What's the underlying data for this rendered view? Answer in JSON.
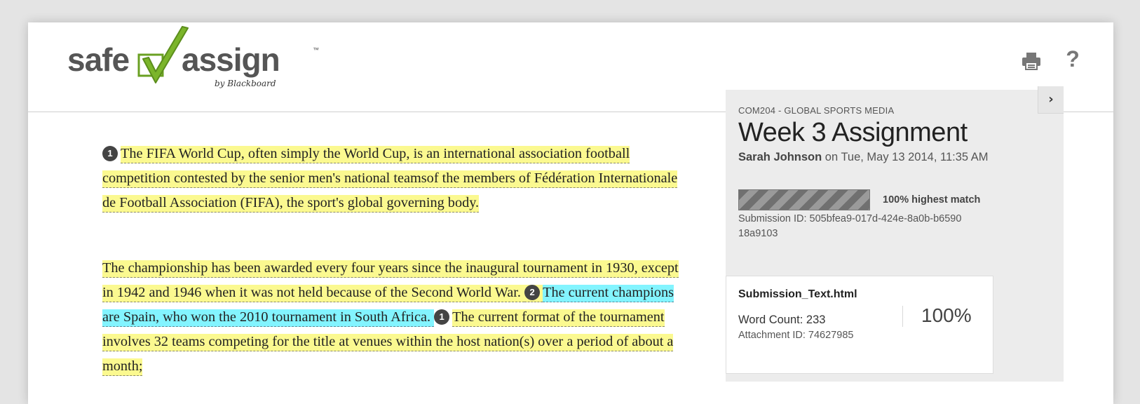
{
  "header": {
    "logo": {
      "word1": "safe",
      "word2": "assign",
      "byline": "by Blackboard",
      "trademark": "™",
      "check_color": "#7bb52a"
    },
    "actions": {
      "print_icon": "printer-icon",
      "help_label": "?"
    }
  },
  "document": {
    "paragraphs": [
      {
        "segments": [
          {
            "type": "marker",
            "text": "1"
          },
          {
            "type": "yellow",
            "text": "The FIFA World Cup, often simply the World Cup, is an international association football competition contested by the senior men's national teamsof the members of Fédération Internationale de Football Association (FIFA), the sport's global governing body."
          }
        ]
      },
      {
        "segments": [
          {
            "type": "yellow",
            "text": " The championship has been awarded every four years since the inaugural tournament in 1930, except in 1942 and 1946 when it was not held because of the Second World War. "
          },
          {
            "type": "marker",
            "text": "2"
          },
          {
            "type": "blue",
            "text": "The current champions are Spain, who won the 2010 tournament in South Africa. "
          },
          {
            "type": "marker",
            "text": "1"
          },
          {
            "type": "yellow",
            "text": "The current format of the tournament involves 32 teams competing for the title at venues within the host nation(s) over a period of about a month;"
          }
        ]
      }
    ],
    "colors": {
      "match_1": "#fbf990",
      "match_2": "#83f4ff"
    }
  },
  "sidebar": {
    "collapse_icon": "chevron-right-icon",
    "course": "COM204 - GLOBAL SPORTS MEDIA",
    "title": "Week 3 Assignment",
    "student": "Sarah Johnson",
    "submitted_prefix": " on ",
    "submitted_date": "Tue, May 13 2014, 11:35 AM",
    "match_fraction": 1.0,
    "match_label": "100% highest match",
    "submission_id": "Submission ID: 505bfea9-017d-424e-8a0b-b659018a9103"
  },
  "attachment": {
    "filename": "Submission_Text.html",
    "word_count": "Word Count: 233",
    "attachment_id": "Attachment ID: 74627985",
    "percent": "100%"
  }
}
